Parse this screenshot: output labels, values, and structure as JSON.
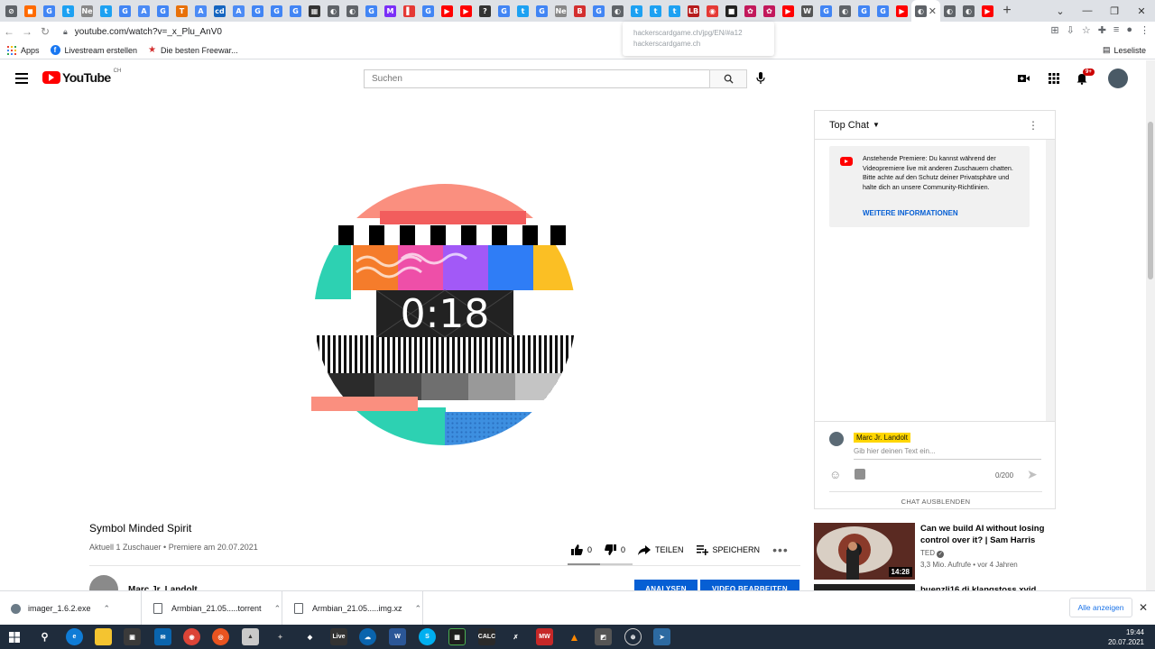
{
  "browser": {
    "tabs": [
      {
        "color": "#5f6368",
        "glyph": "⊘"
      },
      {
        "color": "#ff6a00",
        "glyph": "◼"
      },
      {
        "color": "#4285f4",
        "glyph": "G"
      },
      {
        "color": "#1da1f2",
        "glyph": "t"
      },
      {
        "color": "#888888",
        "glyph": "Ne"
      },
      {
        "color": "#1da1f2",
        "glyph": "t"
      },
      {
        "color": "#4285f4",
        "glyph": "G"
      },
      {
        "color": "#4c8bf5",
        "glyph": "A"
      },
      {
        "color": "#4285f4",
        "glyph": "G"
      },
      {
        "color": "#e8710a",
        "glyph": "T"
      },
      {
        "color": "#4c8bf5",
        "glyph": "A"
      },
      {
        "color": "#1565c0",
        "glyph": "cd"
      },
      {
        "color": "#4c8bf5",
        "glyph": "A"
      },
      {
        "color": "#4285f4",
        "glyph": "G"
      },
      {
        "color": "#4285f4",
        "glyph": "G"
      },
      {
        "color": "#4285f4",
        "glyph": "G"
      },
      {
        "color": "#333333",
        "glyph": "▦"
      },
      {
        "color": "#5f6368",
        "glyph": "◐"
      },
      {
        "color": "#5f6368",
        "glyph": "◐"
      },
      {
        "color": "#4285f4",
        "glyph": "G"
      },
      {
        "color": "#7b2ff7",
        "glyph": "M"
      },
      {
        "color": "#e53935",
        "glyph": "▌"
      },
      {
        "color": "#4285f4",
        "glyph": "G"
      },
      {
        "color": "#ff0000",
        "glyph": "▶"
      },
      {
        "color": "#ff0000",
        "glyph": "▶"
      },
      {
        "color": "#333333",
        "glyph": "?"
      },
      {
        "color": "#4285f4",
        "glyph": "G"
      },
      {
        "color": "#1da1f2",
        "glyph": "t"
      },
      {
        "color": "#4285f4",
        "glyph": "G"
      },
      {
        "color": "#888888",
        "glyph": "Ne"
      },
      {
        "color": "#d32f2f",
        "glyph": "B"
      },
      {
        "color": "#4285f4",
        "glyph": "G"
      },
      {
        "color": "#5f6368",
        "glyph": "◐"
      },
      {
        "color": "#1da1f2",
        "glyph": "t"
      },
      {
        "color": "#1da1f2",
        "glyph": "t"
      },
      {
        "color": "#1da1f2",
        "glyph": "t"
      },
      {
        "color": "#b71c1c",
        "glyph": "LB"
      },
      {
        "color": "#e53935",
        "glyph": "◉"
      },
      {
        "color": "#222222",
        "glyph": "■"
      },
      {
        "color": "#c2185b",
        "glyph": "✿"
      },
      {
        "color": "#c2185b",
        "glyph": "✿"
      },
      {
        "color": "#ff0000",
        "glyph": "▶"
      },
      {
        "color": "#555555",
        "glyph": "W"
      },
      {
        "color": "#4285f4",
        "glyph": "G"
      },
      {
        "color": "#5f6368",
        "glyph": "◐"
      },
      {
        "color": "#4285f4",
        "glyph": "G"
      },
      {
        "color": "#4285f4",
        "glyph": "G"
      },
      {
        "color": "#ff0000",
        "glyph": "▶"
      }
    ],
    "active_tab_close": "✕",
    "tail_tabs": [
      {
        "color": "#5f6368",
        "glyph": "◐"
      },
      {
        "color": "#5f6368",
        "glyph": "◐"
      },
      {
        "color": "#ff0000",
        "glyph": "▶"
      }
    ],
    "new_tab": "+",
    "url": "youtube.com/watch?v=_x_Plu_AnV0",
    "suggestion_line1": "hackerscardgame.ch/jpg/EN/#a12",
    "suggestion_line2": "hackerscardgame.ch",
    "bookmarks": {
      "apps": "Apps",
      "livestream": "Livestream erstellen",
      "freeware": "Die besten Freewar...",
      "reading_list": "Leseliste"
    }
  },
  "youtube": {
    "logo_text": "YouTube",
    "country": "CH",
    "search_placeholder": "Suchen",
    "notification_count": "9+",
    "countdown": "0:18",
    "video_title": "Symbol Minded Spirit",
    "video_meta": "Aktuell 1 Zuschauer • Premiere am 20.07.2021",
    "likes": "0",
    "dislikes": "0",
    "share_label": "TEILEN",
    "save_label": "SPEICHERN",
    "channel_name": "Marc Jr. Landolt",
    "analytics_label": "ANALYSEN",
    "edit_video_label": "VIDEO BEARBEITEN"
  },
  "chat": {
    "header": "Top Chat",
    "premiere_notice": "Anstehende Premiere: Du kannst während der Videopremiere live mit anderen Zuschauern chatten. Bitte achte auf den Schutz deiner Privatsphäre und halte dich an unsere Community-Richtlinien.",
    "more_info": "WEITERE INFORMATIONEN",
    "user_name": "Marc Jr. Landolt",
    "input_placeholder": "Gib hier deinen Text ein...",
    "char_count": "0/200",
    "hide_chat": "CHAT AUSBLENDEN"
  },
  "recommendations": [
    {
      "title": "Can we build AI without losing control over it? | Sam Harris",
      "channel": "TED",
      "meta": "3,3 Mio. Aufrufe • vor 4 Jahren",
      "duration": "14:28"
    },
    {
      "title": "buenzli16 di klangstoss xvid"
    }
  ],
  "downloads": {
    "items": [
      "imager_1.6.2.exe",
      "Armbian_21.05.....torrent",
      "Armbian_21.05.....img.xz"
    ],
    "show_all": "Alle anzeigen"
  },
  "taskbar": {
    "time": "19:44",
    "date": "20.07.2021"
  },
  "colors": {
    "youtube_red": "#ff0000",
    "link_blue": "#065fd4",
    "highlight_yellow": "#ffd600",
    "taskbar": "#1f2c3c"
  }
}
